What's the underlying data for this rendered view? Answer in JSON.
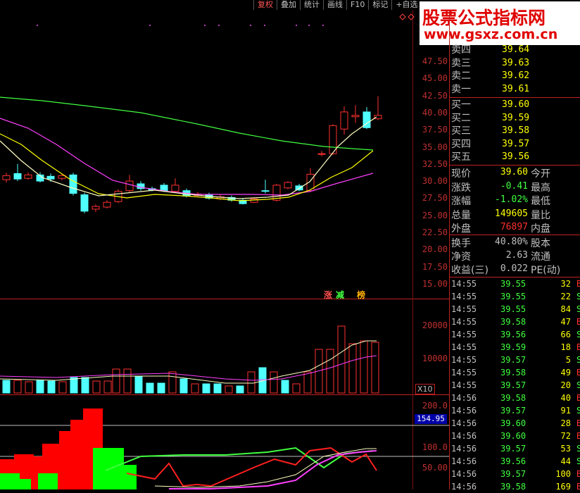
{
  "toolbar": {
    "items": [
      "复权",
      "叠加",
      "统计",
      "画线",
      "F10",
      "标记",
      "+自选"
    ]
  },
  "watermark": {
    "title": "股票公式指标网",
    "url": "www.gsxz.com.cn"
  },
  "price_axis": [
    "47.50",
    "45.00",
    "42.50",
    "40.00",
    "37.50",
    "35.00",
    "32.50",
    "30.00",
    "27.50",
    "25.00",
    "22.50",
    "20.00",
    "17.50",
    "15.00"
  ],
  "volume_axis": [
    "20000",
    "10000"
  ],
  "volume_unit": "X10",
  "indicator_axis": [
    "200.0",
    "100.0",
    "50.00"
  ],
  "indicator_current": "154.95",
  "chips": {
    "zhang": "涨",
    "jian": "减",
    "bang": "榜"
  },
  "orderbook": {
    "asks": [
      {
        "label": "卖四",
        "price": "39.64"
      },
      {
        "label": "卖三",
        "price": "39.63"
      },
      {
        "label": "卖二",
        "price": "39.62"
      },
      {
        "label": "卖一",
        "price": "39.61"
      }
    ],
    "bids": [
      {
        "label": "买一",
        "price": "39.60"
      },
      {
        "label": "买二",
        "price": "39.59"
      },
      {
        "label": "买三",
        "price": "39.58"
      },
      {
        "label": "买四",
        "price": "39.57"
      },
      {
        "label": "买五",
        "price": "39.56"
      }
    ]
  },
  "quote": {
    "xianjia": {
      "label": "现价",
      "value": "39.60",
      "label2": "今开"
    },
    "zhangdie": {
      "label": "涨跌",
      "value": "-0.41",
      "label2": "最高"
    },
    "zhangfu": {
      "label": "涨幅",
      "value": "-1.02%",
      "label2": "最低"
    },
    "zongliang": {
      "label": "总量",
      "value": "149605",
      "label2": "量比"
    },
    "waipan": {
      "label": "外盘",
      "value": "76897",
      "label2": "内盘"
    },
    "huanshou": {
      "label": "换手",
      "value": "40.80%",
      "label2": "股本"
    },
    "jingzi": {
      "label": "净资",
      "value": "2.63",
      "label2": "流通"
    },
    "shouyi": {
      "label": "收益(三)",
      "value": "0.022",
      "label2": "PE(动)"
    }
  },
  "ticks": [
    {
      "time": "14:55",
      "price": "39.55",
      "vol": "32",
      "side": "B"
    },
    {
      "time": "14:55",
      "price": "39.55",
      "vol": "22",
      "side": "S"
    },
    {
      "time": "14:55",
      "price": "39.55",
      "vol": "84",
      "side": "S"
    },
    {
      "time": "14:55",
      "price": "39.58",
      "vol": "47",
      "side": "B"
    },
    {
      "time": "14:55",
      "price": "39.56",
      "vol": "66",
      "side": "S"
    },
    {
      "time": "14:55",
      "price": "39.59",
      "vol": "18",
      "side": "B"
    },
    {
      "time": "14:55",
      "price": "39.57",
      "vol": "5",
      "side": "S"
    },
    {
      "time": "14:55",
      "price": "39.58",
      "vol": "49",
      "side": "B"
    },
    {
      "time": "14:55",
      "price": "39.57",
      "vol": "20",
      "side": "S"
    },
    {
      "time": "14:56",
      "price": "39.58",
      "vol": "40",
      "side": "B"
    },
    {
      "time": "14:56",
      "price": "39.57",
      "vol": "91",
      "side": "S"
    },
    {
      "time": "14:56",
      "price": "39.60",
      "vol": "28",
      "side": "B"
    },
    {
      "time": "14:56",
      "price": "39.60",
      "vol": "72",
      "side": "B"
    },
    {
      "time": "14:56",
      "price": "39.57",
      "vol": "53",
      "side": "S"
    },
    {
      "time": "14:56",
      "price": "39.56",
      "vol": "44",
      "side": "S"
    },
    {
      "time": "14:56",
      "price": "39.57",
      "vol": "100",
      "side": "B"
    },
    {
      "time": "14:56",
      "price": "39.58",
      "vol": "169",
      "side": "B"
    }
  ],
  "colors": {
    "up": "#ff3030",
    "down": "#50ffff",
    "ma_white": "#ffffc0",
    "ma_yellow": "#ffff00",
    "ma_magenta": "#ff40ff",
    "ma_green": "#40ff40"
  }
}
